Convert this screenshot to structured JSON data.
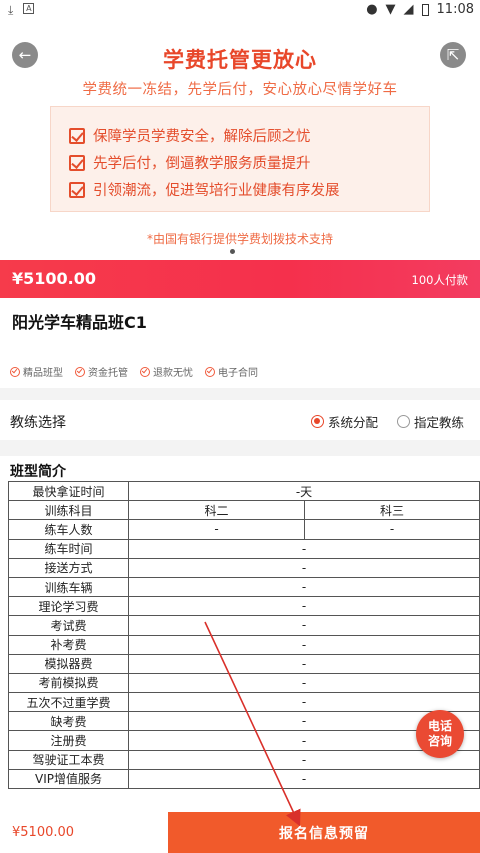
{
  "statusbar": {
    "time": "11:08",
    "left_icons": [
      "download-icon",
      "font-icon"
    ],
    "right_icons": [
      "location-icon",
      "wifi-icon",
      "signal-icon",
      "battery-icon"
    ]
  },
  "banner": {
    "title": "学费托管更放心",
    "subtitle": "学费统一冻结，先学后付，安心放心尽情学好车",
    "features": [
      "保障学员学费安全，解除后顾之忧",
      "先学后付，倒逼教学服务质量提升",
      "引领潮流，促进驾培行业健康有序发展"
    ],
    "bank_note": "*由国有银行提供学费划拨技术支持"
  },
  "price_bar": {
    "price": "¥5100.00",
    "paid_count": "100人付款"
  },
  "course": {
    "name": "阳光学车精品班C1",
    "tags": [
      "精品班型",
      "资金托管",
      "退款无忧",
      "电子合同"
    ]
  },
  "coach": {
    "label": "教练选择",
    "options": [
      {
        "label": "系统分配",
        "selected": true
      },
      {
        "label": "指定教练",
        "selected": false
      }
    ]
  },
  "intro": {
    "title": "班型简介",
    "fastest_label": "最快拿证时间",
    "fastest_value": "-天",
    "subjects_label": "训练科目",
    "subject_2": "科二",
    "subject_3": "科三",
    "students_label": "练车人数",
    "students_2": "-",
    "students_3": "-",
    "rows": [
      {
        "label": "练车时间",
        "value": "-"
      },
      {
        "label": "接送方式",
        "value": "-"
      },
      {
        "label": "训练车辆",
        "value": "-"
      },
      {
        "label": "理论学习费",
        "value": "-"
      },
      {
        "label": "考试费",
        "value": "-"
      },
      {
        "label": "补考费",
        "value": "-"
      },
      {
        "label": "模拟器费",
        "value": "-"
      },
      {
        "label": "考前模拟费",
        "value": "-"
      },
      {
        "label": "五次不过重学费",
        "value": "-"
      },
      {
        "label": "缺考费",
        "value": "-"
      },
      {
        "label": "注册费",
        "value": "-"
      },
      {
        "label": "驾驶证工本费",
        "value": "-"
      },
      {
        "label": "VIP增值服务",
        "value": "-"
      }
    ]
  },
  "consult": {
    "line1": "电话",
    "line2": "咨询"
  },
  "bottom": {
    "price": "¥5100.00",
    "signup": "报名信息预留"
  },
  "colors": {
    "accent": "#e8472a",
    "price_bar": "#f5304c",
    "button": "#f15a2b"
  }
}
